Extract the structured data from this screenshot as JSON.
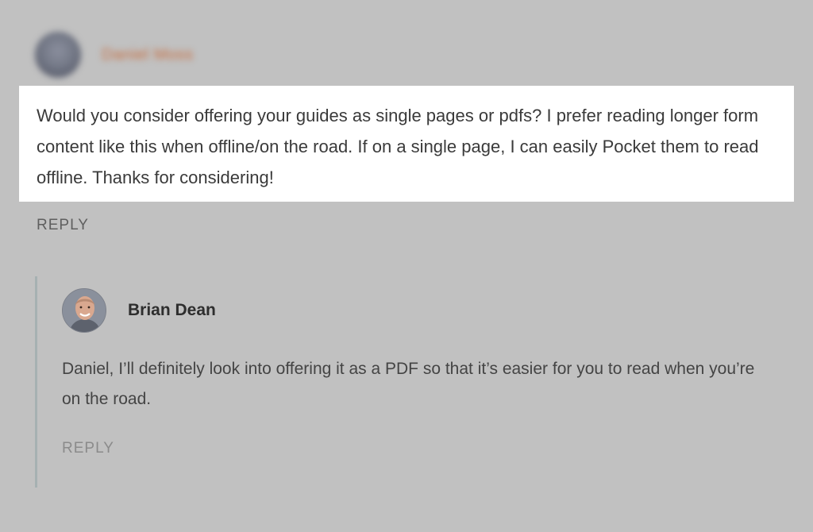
{
  "parent_comment": {
    "author": "Daniel Moss",
    "body": "Would you consider offering your guides as single pages or pdfs? I prefer reading longer form content like this when offline/on the road. If on a single page, I can easily Pocket them to read offline. Thanks for considering!",
    "reply_label": "REPLY"
  },
  "nested_reply": {
    "author": "Brian Dean",
    "body": "Daniel, I’ll definitely look into offering it as a PDF so that it’s easier for you to read when you’re on the road.",
    "reply_label": "REPLY"
  },
  "colors": {
    "background": "#c1c1c1",
    "highlight": "#ffffff",
    "author_accent": "#c56c3e",
    "thread_line": "#a6b1b2"
  }
}
